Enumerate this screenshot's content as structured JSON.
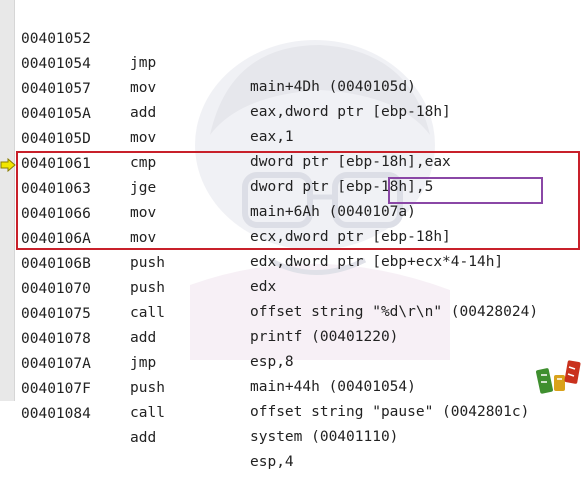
{
  "disassembly": {
    "rows": [
      {
        "addr": "00401052",
        "op": "jmp",
        "args": "main+4Dh (0040105d)"
      },
      {
        "addr": "00401054",
        "op": "mov",
        "args": "eax,dword ptr [ebp-18h]"
      },
      {
        "addr": "00401057",
        "op": "add",
        "args": "eax,1"
      },
      {
        "addr": "0040105A",
        "op": "mov",
        "args": "dword ptr [ebp-18h],eax"
      },
      {
        "addr": "0040105D",
        "op": "cmp",
        "args": "dword ptr [ebp-18h],5"
      },
      {
        "addr": "00401061",
        "op": "jge",
        "args": "main+6Ah (0040107a)"
      },
      {
        "addr": "00401063",
        "op": "mov",
        "args": "ecx,dword ptr [ebp-18h]"
      },
      {
        "addr": "00401066",
        "op": "mov",
        "args": "edx,dword ptr [ebp+ecx*4-14h]"
      },
      {
        "addr": "0040106A",
        "op": "push",
        "args": "edx"
      },
      {
        "addr": "0040106B",
        "op": "push",
        "args": "offset string \"%d\\r\\n\" (00428024)"
      },
      {
        "addr": "00401070",
        "op": "call",
        "args": "printf (00401220)"
      },
      {
        "addr": "00401075",
        "op": "add",
        "args": "esp,8"
      },
      {
        "addr": "00401078",
        "op": "jmp",
        "args": "main+44h (00401054)"
      },
      {
        "addr": "0040107A",
        "op": "push",
        "args": "offset string \"pause\" (0042801c)"
      },
      {
        "addr": "0040107F",
        "op": "call",
        "args": "system (00401110)"
      },
      {
        "addr": "00401084",
        "op": "add",
        "args": "esp,4"
      }
    ],
    "current_instruction_index": 6
  },
  "colors": {
    "highlight_block": "#c8202a",
    "highlight_operand": "#8a47a6",
    "instruction_pointer": "#f2e600"
  },
  "icons": {
    "instruction_pointer": "arrow-right-icon",
    "watermark": "anime-character-watermark",
    "corner_stamp": "decorative-stamp-icon"
  }
}
